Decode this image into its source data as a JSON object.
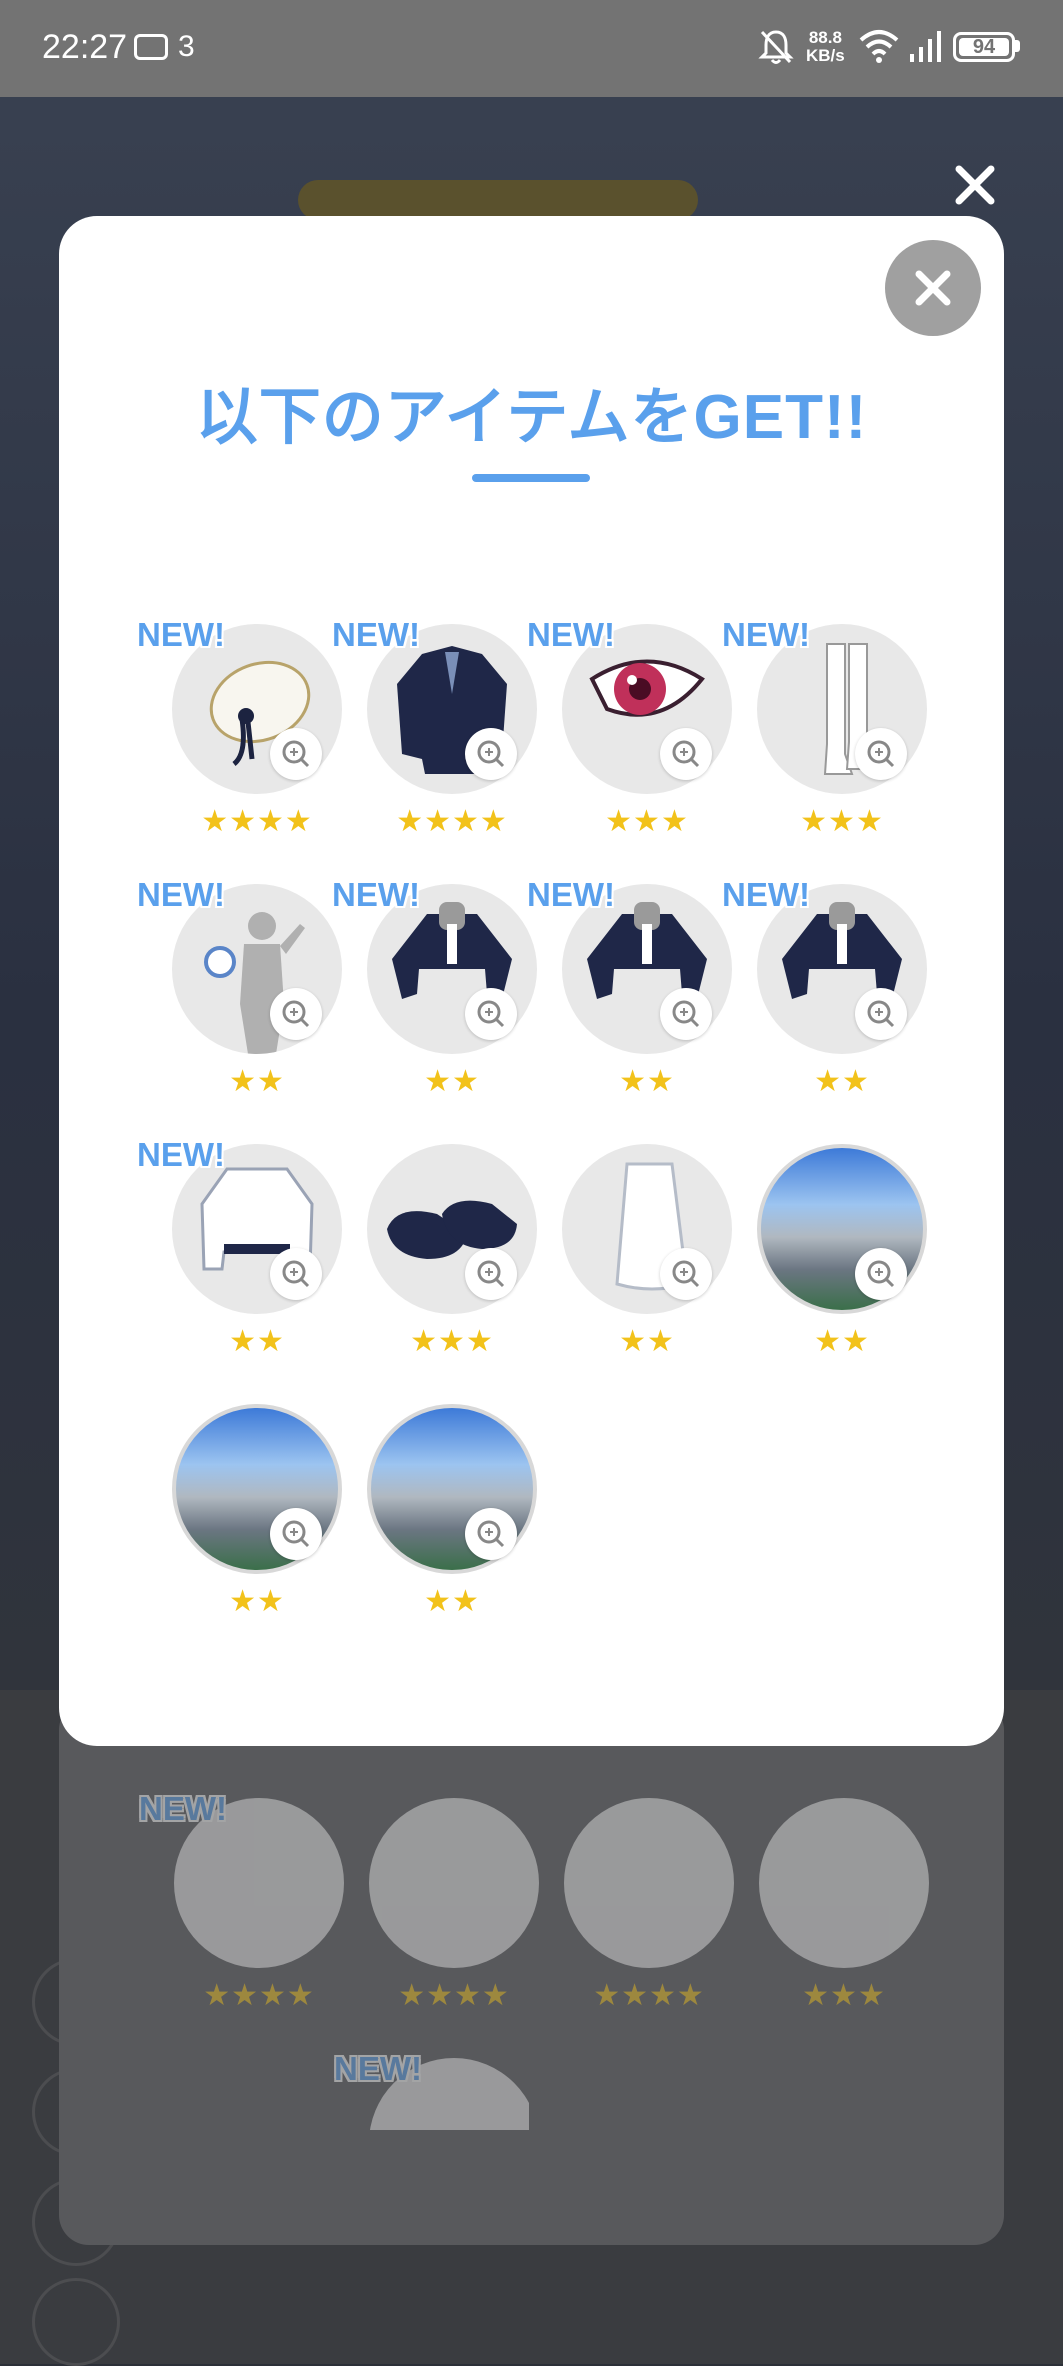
{
  "status_bar": {
    "time": "22:27",
    "notification_count": "3",
    "net_speed_value": "88.8",
    "net_speed_unit": "KB/s",
    "battery": "94"
  },
  "modal": {
    "title": "以下のアイテムをGET!!",
    "items": [
      {
        "new": "NEW!",
        "stars": "★★★★",
        "icon": "hat-icon"
      },
      {
        "new": "NEW!",
        "stars": "★★★★",
        "icon": "blazer-icon"
      },
      {
        "new": "NEW!",
        "stars": "★★★",
        "icon": "eye-icon"
      },
      {
        "new": "NEW!",
        "stars": "★★★",
        "icon": "socks-icon"
      },
      {
        "new": "NEW!",
        "stars": "★★",
        "icon": "hand-accessory-icon"
      },
      {
        "new": "NEW!",
        "stars": "★★",
        "icon": "jacket-icon"
      },
      {
        "new": "NEW!",
        "stars": "★★",
        "icon": "jacket-icon"
      },
      {
        "new": "NEW!",
        "stars": "★★",
        "icon": "jacket-icon"
      },
      {
        "new": "NEW!",
        "stars": "★★",
        "icon": "white-jacket-icon"
      },
      {
        "new": "",
        "stars": "★★★",
        "icon": "shoes-icon"
      },
      {
        "new": "",
        "stars": "★★",
        "icon": "skirt-icon"
      },
      {
        "new": "",
        "stars": "★★",
        "icon": "background-scene-icon"
      },
      {
        "new": "",
        "stars": "★★",
        "icon": "background-scene-icon"
      },
      {
        "new": "",
        "stars": "★★",
        "icon": "background-scene-icon"
      }
    ]
  },
  "background": {
    "items": [
      {
        "new": "NEW!",
        "stars": "★★★★"
      },
      {
        "new": "",
        "stars": "★★★★"
      },
      {
        "new": "",
        "stars": "★★★★"
      },
      {
        "new": "",
        "stars": "★★★"
      }
    ],
    "second_row_new": "NEW!"
  },
  "colors": {
    "accent": "#5aa0ec",
    "star": "#f2c21a"
  }
}
